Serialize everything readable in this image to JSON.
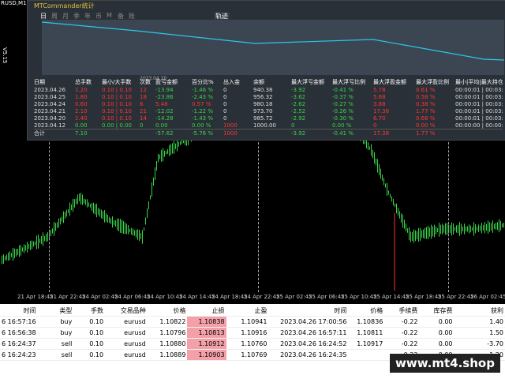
{
  "symbol": "RUSD,M15",
  "left_price": "V5.15",
  "panel": {
    "title": "MTCommander统计",
    "toolbar": [
      "日",
      "周",
      "月",
      "季",
      "年",
      "币",
      "M",
      "备",
      "账户"
    ],
    "active_tab": "日",
    "traj_label": "轨迹",
    "graph_date": "2023.04.20"
  },
  "stats": {
    "headers": [
      "日期",
      "总手数",
      "最小/大手数",
      "次数",
      "盈亏金额",
      "百分比%",
      "出入金",
      "余额",
      "最大浮亏金额",
      "最大浮亏比例",
      "最大浮盈金额",
      "最大浮盈比例",
      "最小|平均|最大持仓时间"
    ],
    "rows": [
      [
        "2023.04.26",
        "1.20",
        "0.10 | 0.10",
        "12",
        "-13.94",
        "-1.46 %",
        "0",
        "940.38",
        "-3.92",
        "-0.41 %",
        "5.78",
        "0.61 %",
        "00:00:01 | 00:03:35 | 00:1"
      ],
      [
        "2023.04.25",
        "1.80",
        "0.10 | 0.10",
        "18",
        "-23.86",
        "-2.43 %",
        "0",
        "956.32",
        "-3.62",
        "-0.37 %",
        "5.68",
        "0.58 %",
        "00:00:01 | 00:03:11 | 00:1"
      ],
      [
        "2023.04.24",
        "0.60",
        "0.10 | 0.10",
        "6",
        "5.48",
        "0.57 %",
        "0",
        "980.18",
        "-2.62",
        "-0.27 %",
        "3.88",
        "0.38 %",
        "00:00:01 | 00:03:08 | 00:1"
      ],
      [
        "2023.04.21",
        "2.10",
        "0.10 | 0.10",
        "21",
        "-12.02",
        "-1.22 %",
        "0",
        "973.70",
        "-2.52",
        "-0.26 %",
        "17.38",
        "1.77 %",
        "00:00:01 | 00:03:36 | 00:1"
      ],
      [
        "2023.04.20",
        "1.40",
        "0.10 | 0.10",
        "14",
        "-14.28",
        "-1.43 %",
        "0",
        "985.72",
        "-2.92",
        "-0.30 %",
        "6.70",
        "0.68 %",
        "00:00:01 | 00:03:01 | 00:1"
      ],
      [
        "2023.04.12",
        "0.00",
        "0.00 | 0.00",
        "0",
        "0.00",
        "0.00 %",
        "1000",
        "1000.00",
        "0",
        "0.00 %",
        "0",
        "0.00 %",
        "00:00:00 | 00:00:00 | 00:0"
      ]
    ],
    "total": [
      "合计",
      "7.10",
      "",
      "",
      "-57.62",
      "-5.76 %",
      "1000",
      "",
      "-3.92",
      "-0.41 %",
      "17.38",
      "1.77 %",
      ""
    ]
  },
  "time_ticks": [
    "21 Apr 18:45",
    "21 Apr 22:45",
    "24 Apr 02:45",
    "24 Apr 06:45",
    "24 Apr 10:45",
    "24 Apr 14:45",
    "24 Apr 18:45",
    "24 Apr 22:45",
    "25 Apr 02:45",
    "25 Apr 06:45",
    "25 Apr 10:45",
    "25 Apr 14:45",
    "25 Apr 18:45",
    "25 Apr 22:45",
    "26 Apr 02:45"
  ],
  "orders": {
    "headers": [
      "时间",
      "类型",
      "手数",
      "交易品种",
      "价格",
      "止损",
      "止盈",
      "时间",
      "价格",
      "手续费",
      "库存费",
      "获利"
    ],
    "rows": [
      [
        "6 16:57:16",
        "buy",
        "0.10",
        "eurusd",
        "1.10822",
        "1.10838",
        "1.10941",
        "2023.04.26 17:00:56",
        "1.10836",
        "-0.22",
        "0.00",
        "1.40"
      ],
      [
        "6 16:56:38",
        "buy",
        "0.10",
        "eurusd",
        "1.10796",
        "1.10813",
        "1.10916",
        "2023.04.26 16:57:11",
        "1.10811",
        "-0.22",
        "0.00",
        "1.50"
      ],
      [
        "6 16:24:37",
        "sell",
        "0.10",
        "eurusd",
        "1.10880",
        "1.10912",
        "1.10760",
        "2023.04.26 16:24:52",
        "1.10917",
        "-0.22",
        "0.00",
        "-3.70"
      ],
      [
        "6 16:24:23",
        "sell",
        "0.10",
        "eurusd",
        "1.10889",
        "1.10903",
        "1.10769",
        "2023.04.26 16:24:35",
        "",
        "-0.22",
        "0.00",
        "1.20"
      ]
    ]
  },
  "watermark": "www.mt4.shop",
  "colors": {
    "bull": "#39d24a",
    "bear": "#ff3333",
    "line": "#28c8e8",
    "panel": "#2a3037"
  }
}
